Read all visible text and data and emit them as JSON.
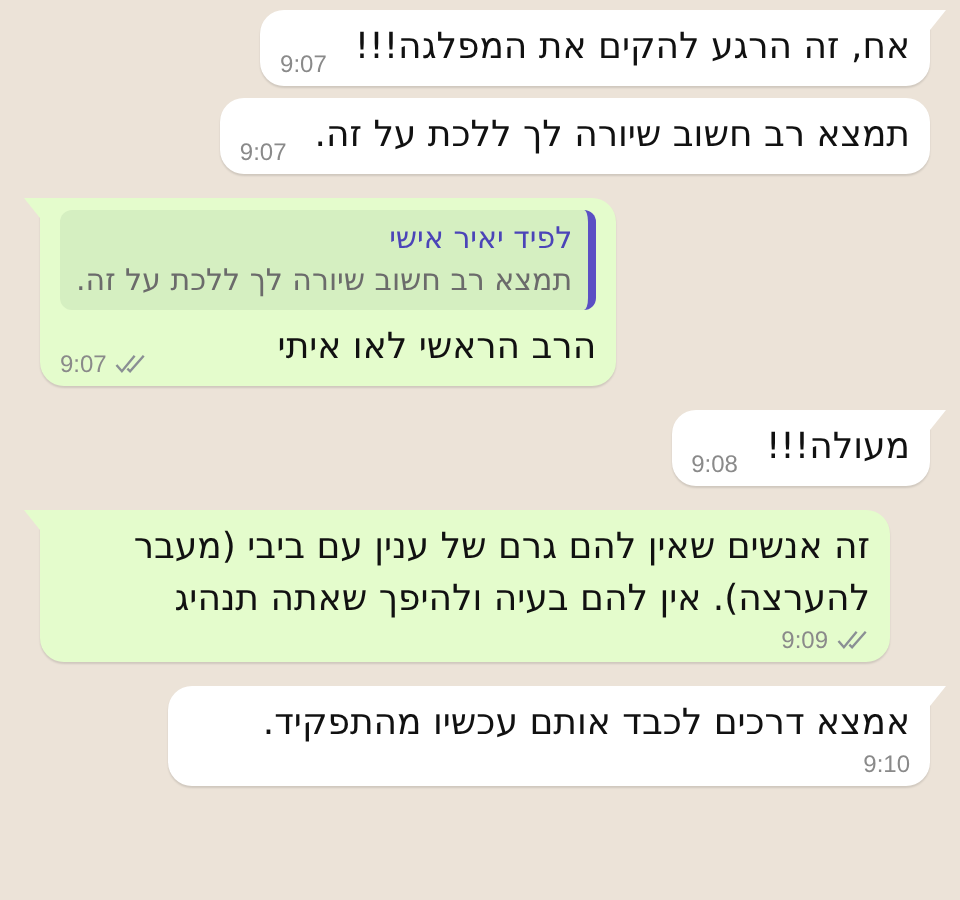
{
  "messages": [
    {
      "kind": "incoming",
      "tail": true,
      "text": "אח, זה הרגע להקים את המפלגה!!!",
      "time": "9:07"
    },
    {
      "kind": "incoming",
      "tail": false,
      "text": "תמצא רב חשוב שיורה לך ללכת על זה.",
      "time": "9:07"
    },
    {
      "kind": "outgoing",
      "tail": true,
      "quote": {
        "author": "לפיד יאיר אישי",
        "text": "תמצא רב חשוב שיורה לך ללכת על זה."
      },
      "text": "הרב הראשי לאו איתי",
      "time": "9:07",
      "read": false
    },
    {
      "kind": "incoming",
      "tail": true,
      "text": "מעולה!!!",
      "time": "9:08"
    },
    {
      "kind": "outgoing",
      "tail": true,
      "text": "זה אנשים שאין להם גרם של ענין עם ביבי (מעבר להערצה). אין להם בעיה ולהיפך שאתה תנהיג",
      "time": "9:09",
      "read": false
    },
    {
      "kind": "incoming",
      "tail": true,
      "text": "אמצא דרכים לכבד אותם עכשיו מהתפקיד.",
      "time": "9:10"
    }
  ]
}
